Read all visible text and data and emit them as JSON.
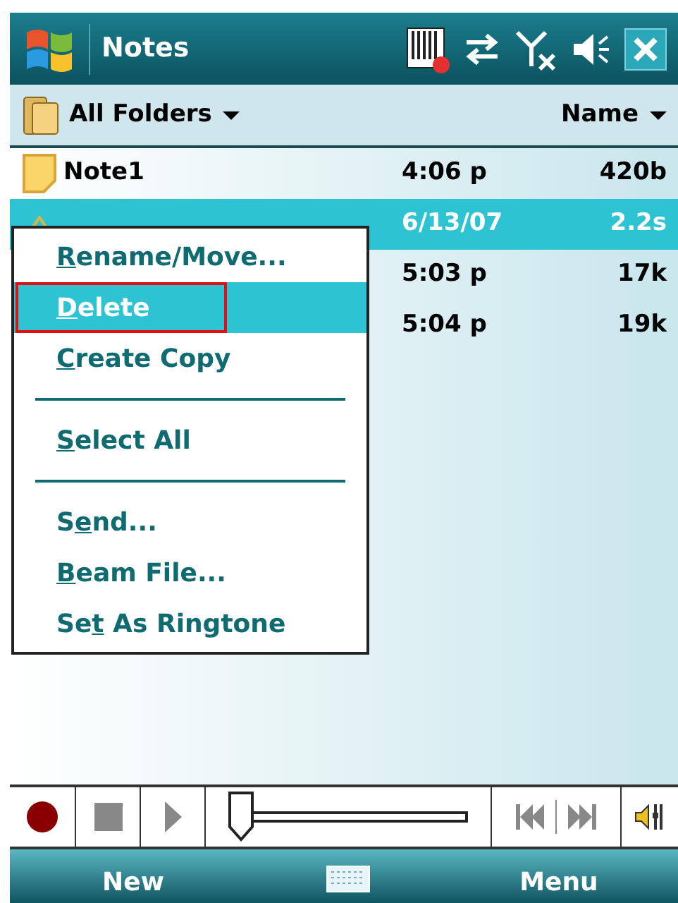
{
  "title_bar": {
    "title": "Notes"
  },
  "folder_bar": {
    "folder": "All Folders",
    "sort": "Name"
  },
  "rows": [
    {
      "name": "Note1",
      "kind": "note",
      "col_2": "4:06 p",
      "col_3": "420b",
      "selected": false
    },
    {
      "kind": "recording",
      "col_2": "6/13/07",
      "col_3": "2.2s",
      "selected": true
    },
    {
      "kind": "hidden",
      "col_2": "5:03 p",
      "col_3": "17k",
      "selected": false
    },
    {
      "kind": "hidden",
      "col_2": "5:04 p",
      "col_3": "19k",
      "selected": false
    }
  ],
  "context_menu": [
    {
      "kind": "item",
      "key": "R",
      "after": "ename/Move...",
      "selected": false
    },
    {
      "kind": "item",
      "key": "D",
      "after": "elete",
      "selected": true
    },
    {
      "kind": "item",
      "key": "C",
      "after": "reate Copy",
      "selected": false
    },
    {
      "kind": "separator"
    },
    {
      "kind": "item",
      "key": "S",
      "after": "elect All",
      "selected": false
    },
    {
      "kind": "separator"
    },
    {
      "kind": "item",
      "before": "S",
      "key": "e",
      "after": "nd...",
      "selected": false
    },
    {
      "kind": "item",
      "key": "B",
      "after": "eam File...",
      "selected": false
    },
    {
      "kind": "item",
      "before": "Se",
      "key": "t",
      "after": " As Ringtone",
      "selected": false
    }
  ],
  "player": {
    "level": 0
  },
  "soft_keys": {
    "left": "New",
    "right": "Menu"
  }
}
